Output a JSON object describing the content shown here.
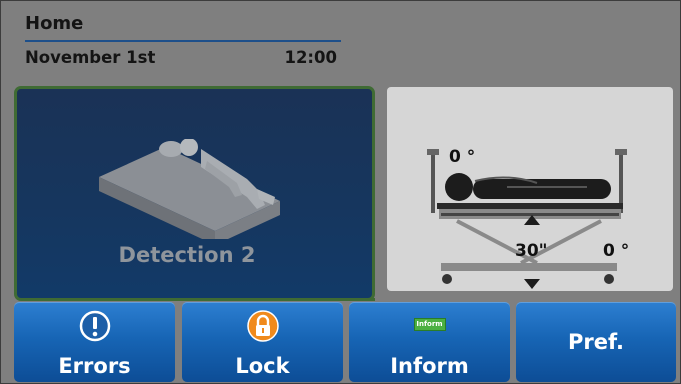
{
  "header": {
    "title": "Home",
    "date": "November 1st",
    "time": "12:00"
  },
  "detection": {
    "label": "Detection 2",
    "icon": "bed-patient-icon"
  },
  "angles": {
    "head_angle": "0 °",
    "tilt_angle": "0 °",
    "height": "30\""
  },
  "buttons": {
    "errors": {
      "label": "Errors",
      "icon": "exclamation-icon"
    },
    "lock": {
      "label": "Lock",
      "icon": "padlock-icon"
    },
    "inform": {
      "label": "Inform",
      "chip": "Inform",
      "icon": "inform-icon"
    },
    "pref": {
      "label": "Pref."
    }
  },
  "colors": {
    "background": "#7f7f7f",
    "accent_blue": "#1765b5",
    "tile_green_outline": "#3f6b34",
    "tile_blue": "#16365e",
    "lock_orange": "#f08a1c",
    "inform_green": "#4bb042"
  }
}
